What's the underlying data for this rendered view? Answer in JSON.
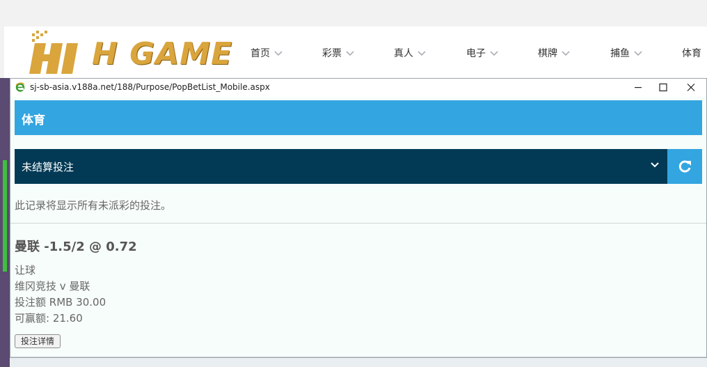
{
  "logo": {
    "text": "H GAME"
  },
  "nav": [
    {
      "label": "首页"
    },
    {
      "label": "彩票"
    },
    {
      "label": "真人"
    },
    {
      "label": "电子"
    },
    {
      "label": "棋牌"
    },
    {
      "label": "捕鱼"
    },
    {
      "label": "体育"
    }
  ],
  "popup": {
    "url": "sj-sb-asia.v188a.net/188/Purpose/PopBetList_Mobile.aspx",
    "header_title": "体育",
    "filter_selected": "未结算投注",
    "description": "此记录将显示所有未派彩的投注。",
    "bet": {
      "title": "曼联 -1.5/2 @ 0.72",
      "type": "让球",
      "match": "维冈竞技 v 曼联",
      "stake": "投注额 RMB 30.00",
      "to_win": "可赢额: 21.60",
      "details_button": "投注详情"
    }
  },
  "colors": {
    "header_blue": "#33a5e0",
    "select_navy": "#023a55",
    "logo_gold": "#d9a53c"
  },
  "icons": [
    "ie-icon",
    "minimize-icon",
    "maximize-icon",
    "close-icon",
    "chevron-down-icon",
    "refresh-icon"
  ]
}
